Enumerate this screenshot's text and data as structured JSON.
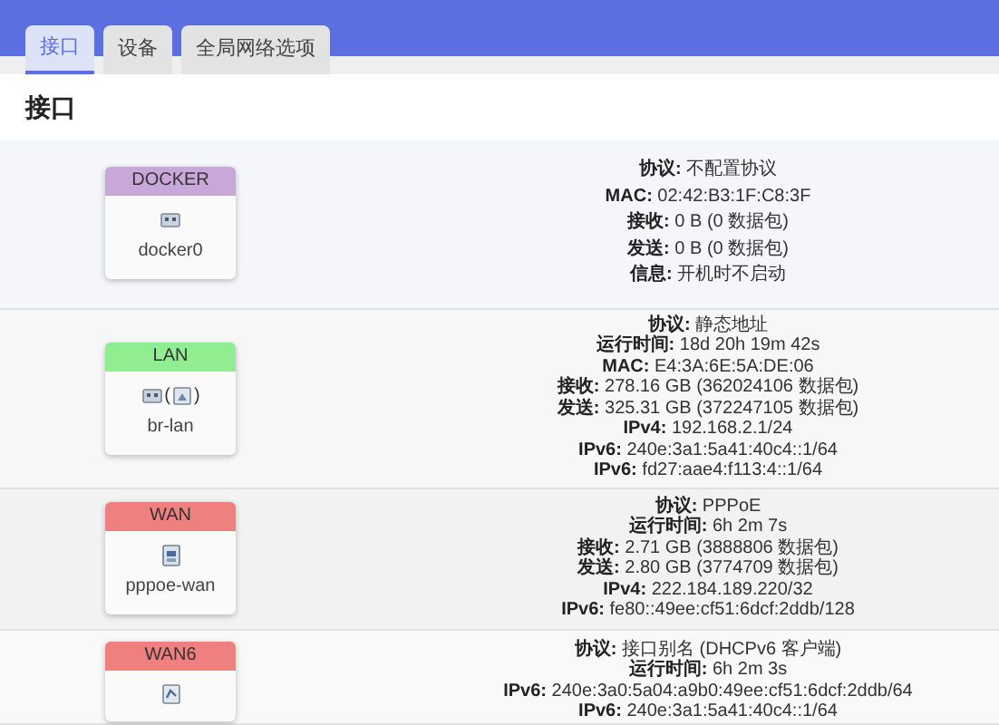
{
  "tabs": [
    {
      "label": "接口",
      "selected": true
    },
    {
      "label": "设备",
      "selected": false
    },
    {
      "label": "全局网络选项",
      "selected": false
    }
  ],
  "section_title": "接口",
  "interfaces": [
    {
      "name": "DOCKER",
      "color": "#c8a8d8",
      "kind": "ethernet",
      "device": "docker0",
      "details": [
        {
          "label": "协议:",
          "value": "不配置协议"
        },
        {
          "label": "MAC:",
          "value": "02:42:B3:1F:C8:3F"
        },
        {
          "label": "接收:",
          "value": "0 B (0 数据包)"
        },
        {
          "label": "发送:",
          "value": "0 B (0 数据包)"
        },
        {
          "label": "信息:",
          "value": "开机时不启动"
        }
      ]
    },
    {
      "name": "LAN",
      "color": "#90ee90",
      "kind": "bridge",
      "bracket_open": "(",
      "bracket_close": ")",
      "device": "br-lan",
      "details": [
        {
          "label": "协议:",
          "value": "静态地址"
        },
        {
          "label": "运行时间:",
          "value": "18d 20h 19m 42s"
        },
        {
          "label": "MAC:",
          "value": "E4:3A:6E:5A:DE:06"
        },
        {
          "label": "接收:",
          "value": "278.16 GB (362024106 数据包)"
        },
        {
          "label": "发送:",
          "value": "325.31 GB (372247105 数据包)"
        },
        {
          "label": "IPv4:",
          "value": "192.168.2.1/24"
        },
        {
          "label": "IPv6:",
          "value": "240e:3a1:5a41:40c4::1/64"
        },
        {
          "label": "IPv6:",
          "value": "fd27:aae4:f113:4::1/64"
        }
      ]
    },
    {
      "name": "WAN",
      "color": "#f08080",
      "kind": "tunnel",
      "device": "pppoe-wan",
      "details": [
        {
          "label": "协议:",
          "value": "PPPoE"
        },
        {
          "label": "运行时间:",
          "value": "6h 2m 7s"
        },
        {
          "label": "接收:",
          "value": "2.71 GB (3888806 数据包)"
        },
        {
          "label": "发送:",
          "value": "2.80 GB (3774709 数据包)"
        },
        {
          "label": "IPv4:",
          "value": "222.184.189.220/32"
        },
        {
          "label": "IPv6:",
          "value": "fe80::49ee:cf51:6dcf:2ddb/128"
        }
      ]
    },
    {
      "name": "WAN6",
      "color": "#f08080",
      "kind": "alias",
      "details": [
        {
          "label": "协议:",
          "value": "接口别名 (DHCPv6 客户端)"
        },
        {
          "label": "运行时间:",
          "value": "6h 2m 3s"
        },
        {
          "label": "IPv6:",
          "value": "240e:3a0:5a04:a9b0:49ee:cf51:6dcf:2ddb/64"
        },
        {
          "label": "IPv6:",
          "value": "240e:3a1:5a41:40c4::1/64"
        }
      ]
    }
  ]
}
